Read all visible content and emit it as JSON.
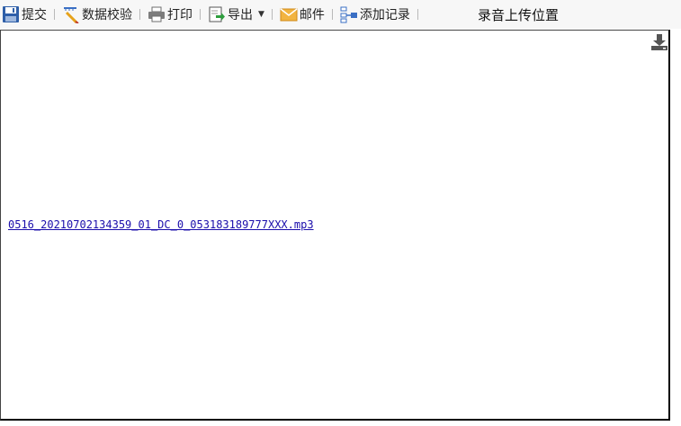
{
  "toolbar": {
    "submit_label": "提交",
    "validate_label": "数据校验",
    "print_label": "打印",
    "export_label": "导出",
    "mail_label": "邮件",
    "add_record_label": "添加记录",
    "icons": [
      "save-icon",
      "ruler-pencil-icon",
      "printer-icon",
      "export-icon",
      "mail-icon",
      "add-record-icon"
    ]
  },
  "upload_title": "录音上传位置",
  "attachment": {
    "filename": "0516_20210702134359_01_DC_0_053183189777XXX.mp3",
    "icon": "download-icon"
  },
  "colors": {
    "link": "#1a0dab",
    "toolbar_bg": "#f7f7f7"
  }
}
